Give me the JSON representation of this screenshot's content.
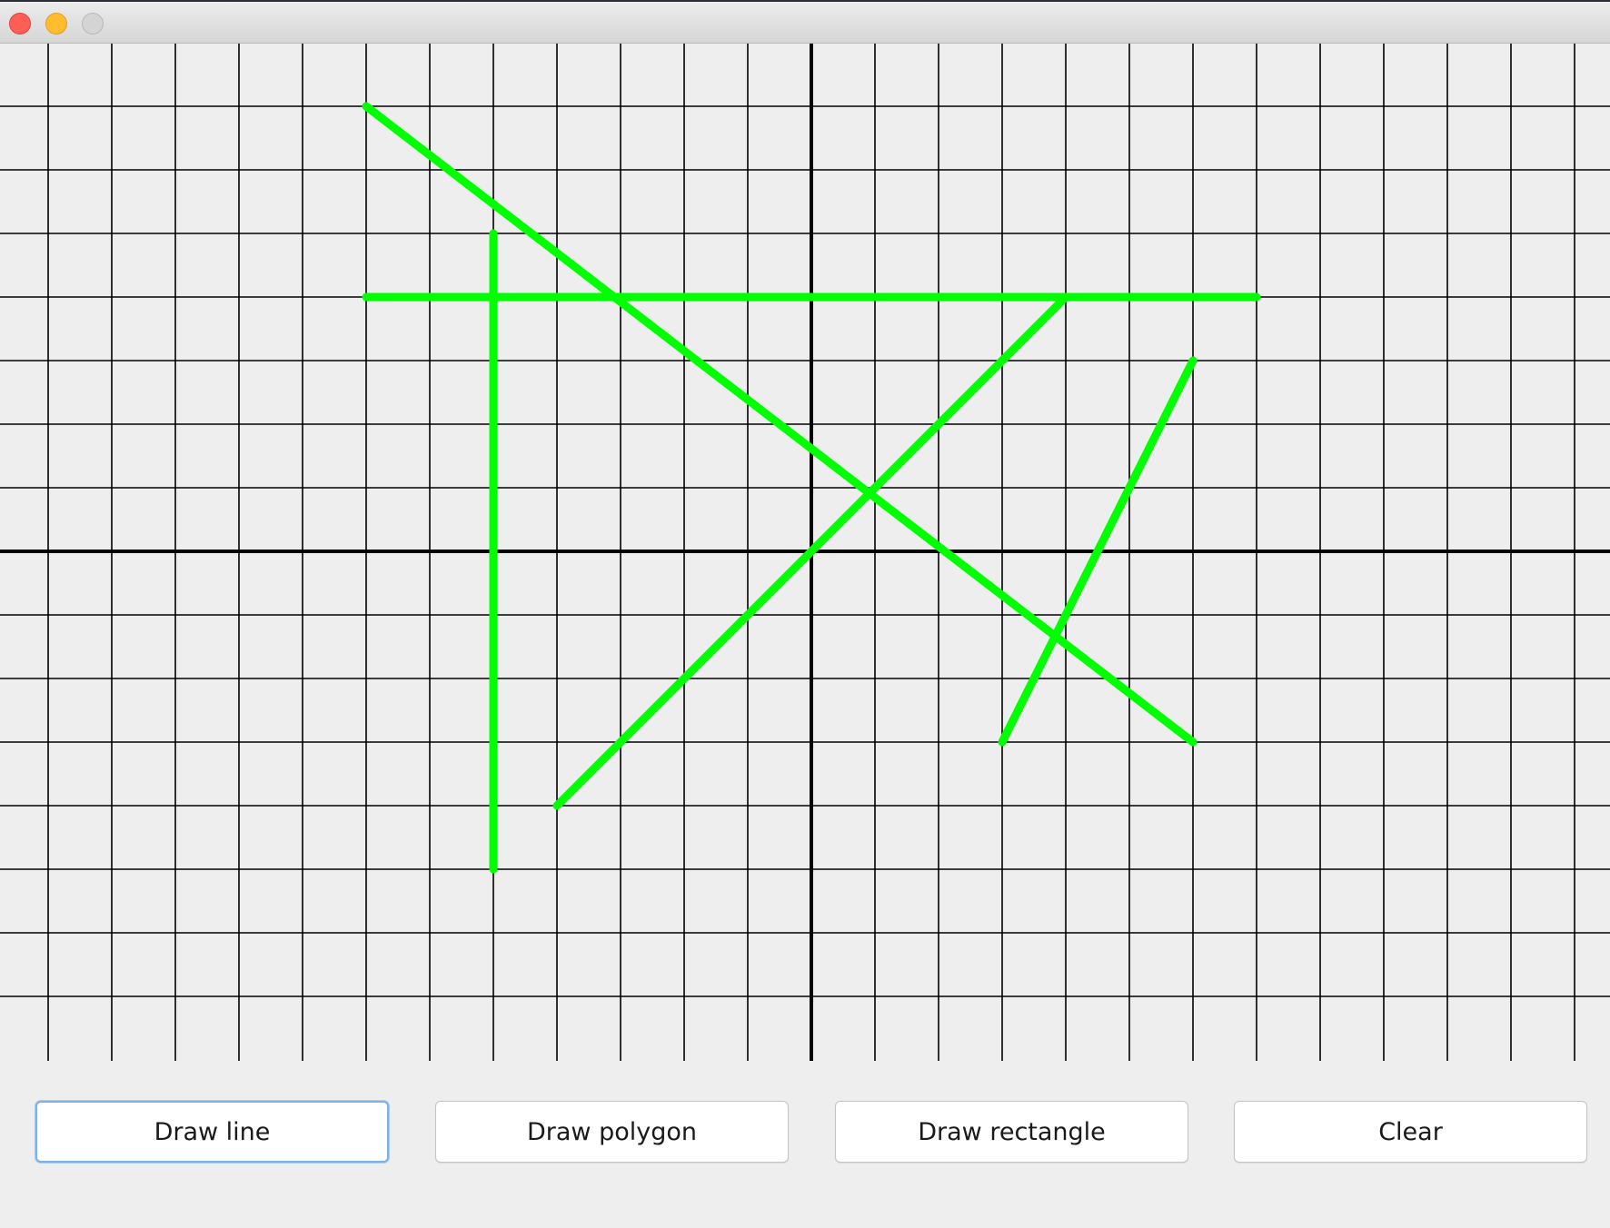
{
  "window": {
    "title": "",
    "traffic_lights": [
      "close",
      "minimize",
      "zoom"
    ]
  },
  "canvas": {
    "background": "#eeeeee",
    "grid_color": "#000000",
    "axis_color": "#000000",
    "grid_step_units": 1,
    "x_range": [
      -13,
      13
    ],
    "y_range": [
      -8,
      8
    ],
    "stroke_color": "#00ff00",
    "segments": [
      {
        "from": [
          -7,
          7
        ],
        "to": [
          6,
          -3
        ]
      },
      {
        "from": [
          -5,
          5
        ],
        "to": [
          -5,
          -5
        ]
      },
      {
        "from": [
          -7,
          4
        ],
        "to": [
          7,
          4
        ]
      },
      {
        "from": [
          4,
          4
        ],
        "to": [
          -4,
          -4
        ]
      },
      {
        "from": [
          6,
          3
        ],
        "to": [
          3,
          -3
        ]
      }
    ]
  },
  "toolbar": {
    "draw_line_label": "Draw line",
    "draw_polygon_label": "Draw polygon",
    "draw_rectangle_label": "Draw rectangle",
    "clear_label": "Clear",
    "focused_button": "draw-line"
  }
}
